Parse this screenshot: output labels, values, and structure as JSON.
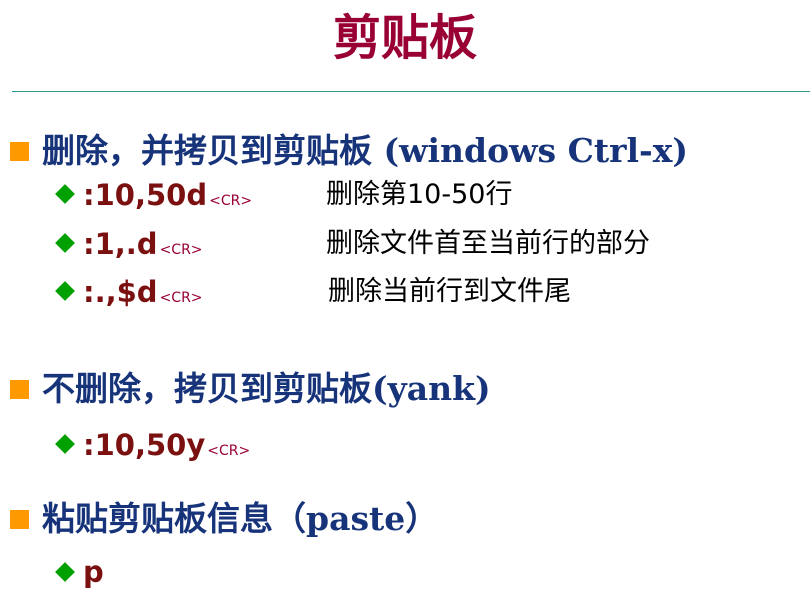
{
  "title": "剪贴板",
  "sections": [
    {
      "heading": "删除，并拷贝到剪贴板 (windows Ctrl-x)",
      "items": [
        {
          "cmd": ":10,50d",
          "key": "<CR>",
          "desc": "删除第10-50行"
        },
        {
          "cmd": ":1,.d",
          "key": "<CR>",
          "desc": "删除文件首至当前行的部分"
        },
        {
          "cmd": ":.,$d",
          "key": "<CR>",
          "desc": "删除当前行到文件尾"
        }
      ]
    },
    {
      "heading": "不删除，拷贝到剪贴板(yank)",
      "items": [
        {
          "cmd": ":10,50y",
          "key": "<CR>"
        }
      ]
    },
    {
      "heading": "粘贴剪贴板信息（paste）",
      "items": [
        {
          "cmd": "p"
        }
      ]
    }
  ],
  "colors": {
    "title": "#990033",
    "heading": "#17347a",
    "command": "#7a1010",
    "square_bullet": "#ff9900",
    "diamond_bullet": "#00a000",
    "rule": "#2f9c91"
  }
}
